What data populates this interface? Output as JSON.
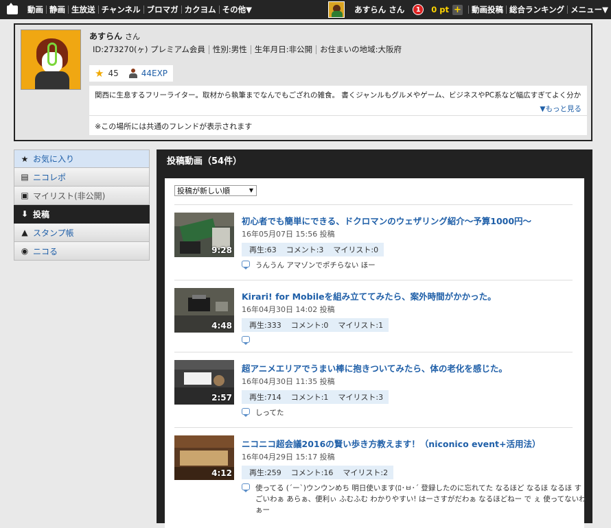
{
  "topbar": {
    "nav": [
      "動画",
      "静画",
      "生放送",
      "チャンネル",
      "ブロマガ",
      "カクヨム",
      "その他▼"
    ],
    "user_label": "あすらん さん",
    "notification_count": "1",
    "points": "0 pt",
    "plus": "+",
    "links": [
      "動画投稿",
      "総合ランキング",
      "メニュー▼"
    ]
  },
  "profile": {
    "name": "あすらん",
    "honorific": "さん",
    "meta": [
      "ID:273270(ヶ) プレミアム会員",
      "性別:男性",
      "生年月日:非公開",
      "お住まいの地域:大阪府"
    ],
    "stars": "45",
    "exp": "44EXP",
    "description": "関西に生息するフリーライター。取材から執筆までなんでもござれの雑食。 書くジャンルもグルメやゲーム、ビジネスやPC系など幅広すぎてよく分か",
    "more_label": "▼もっと見る",
    "friends_note": "※この場所には共通のフレンドが表示されます"
  },
  "sidebar": {
    "items": [
      {
        "label": "お気に入り",
        "icon": "★"
      },
      {
        "label": "ニコレポ",
        "icon": "▤"
      },
      {
        "label": "マイリスト(非公開)",
        "icon": "▣"
      },
      {
        "label": "投稿",
        "icon": "⬇"
      },
      {
        "label": "スタンプ帳",
        "icon": "▲"
      },
      {
        "label": "ニコる",
        "icon": "◉"
      }
    ]
  },
  "main": {
    "title": "投稿動画（54件）",
    "sort": "投稿が新しい順",
    "videos": [
      {
        "title": "初心者でも簡単にできる、ドクロマンのウェザリング紹介～予算1000円～",
        "date": "16年05月07日 15:56 投稿",
        "views": "再生:63",
        "comments": "コメント:3",
        "mylist": "マイリスト:0",
        "duration": "9:28",
        "comment": "うんうん アマゾンでポチらない ほー"
      },
      {
        "title": "Kirari! for Mobileを組み立ててみたら、案外時間がかかった。",
        "date": "16年04月30日 14:02 投稿",
        "views": "再生:333",
        "comments": "コメント:0",
        "mylist": "マイリスト:1",
        "duration": "4:48",
        "comment": ""
      },
      {
        "title": "超アニメエリアでうまい棒に抱きついてみたら、体の老化を感じた。",
        "date": "16年04月30日 11:35 投稿",
        "views": "再生:714",
        "comments": "コメント:1",
        "mylist": "マイリスト:3",
        "duration": "2:57",
        "comment": "しってた"
      },
      {
        "title": "ニコニコ超会議2016の賢い歩き方教えます！（niconico event+活用法）",
        "date": "16年04月29日 15:17 投稿",
        "views": "再生:259",
        "comments": "コメント:16",
        "mylist": "マイリスト:2",
        "duration": "4:12",
        "comment": "使ってる (´ー`)ウンウンめち 明日使います(ﾛ･ㅂ･´ 登録したのに忘れてた なるほど なるほ なるほ すごいわぁ あらぁ、便利ぃ ふむふむ わかりやすい! はーさすがだわぁ なるほどねー で ぇ 使ってないわぁー"
      }
    ]
  }
}
